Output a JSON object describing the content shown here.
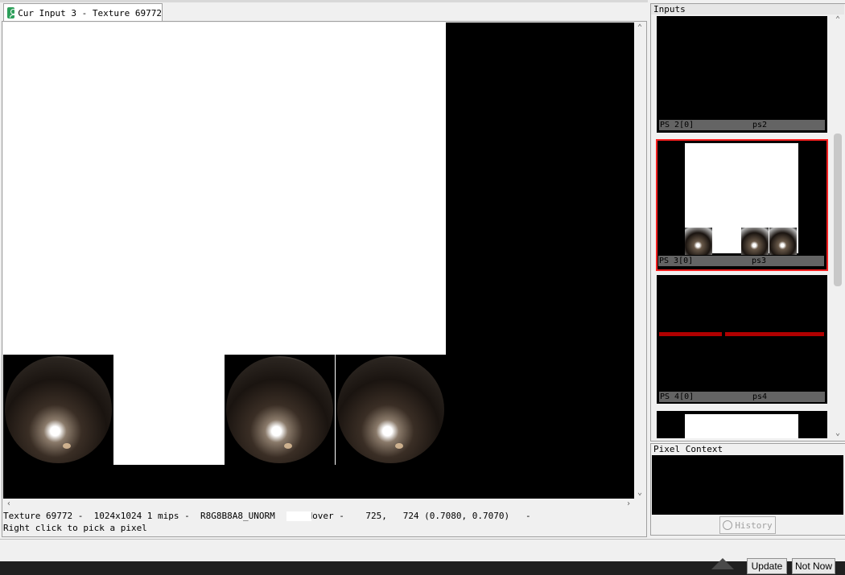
{
  "tab": {
    "title": "Cur Input 3 - Texture 69772"
  },
  "status": {
    "line1": "Texture 69772 -  1024x1024 1 mips -  R8G8B8A8_UNORM      Hover -    725,   724 (0.7080, 0.7070)   -",
    "line2": "Right click to pick a pixel"
  },
  "inputs_panel": {
    "title": "Inputs",
    "thumbnails": [
      {
        "left": "PS 2[0]",
        "right": "ps2",
        "selected": false
      },
      {
        "left": "PS 3[0]",
        "right": "ps3",
        "selected": true
      },
      {
        "left": "PS 4[0]",
        "right": "ps4",
        "selected": false
      }
    ]
  },
  "pixel_context": {
    "title": "Pixel Context",
    "history_label": "History"
  },
  "notification": {
    "update_label": "Update",
    "not_now_label": "Not Now"
  },
  "colors": {
    "selected_border": "#ff2020",
    "hover_swatch": "#ffffff",
    "red_line": "#b00000"
  },
  "icons": {
    "tab": "texture-viewer-icon",
    "history": "history-icon",
    "scroll_up": "arrow-up",
    "scroll_down": "arrow-down",
    "scroll_left": "arrow-left",
    "scroll_right": "arrow-right"
  }
}
